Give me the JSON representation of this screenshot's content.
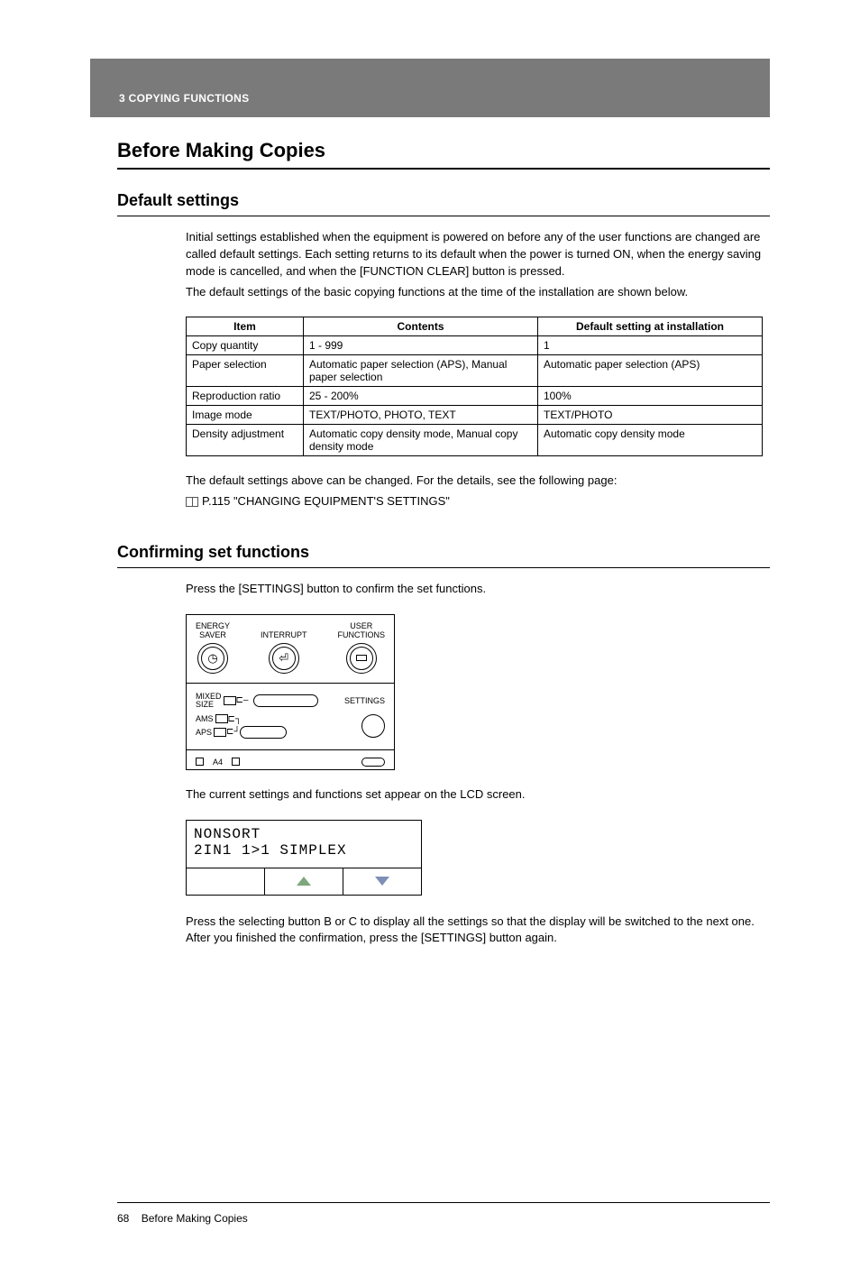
{
  "header": {
    "chapter_label": "3   COPYING FUNCTIONS"
  },
  "title": "Before Making Copies",
  "sub1": {
    "heading": "Default settings",
    "p1": "Initial settings established when the equipment is powered on before any of the user functions are changed are called default settings. Each setting returns to its default when the power is turned ON, when the energy saving mode is cancelled, and when the [FUNCTION CLEAR] button is pressed.",
    "p2": "The default settings of the basic copying functions at the time of the installation are shown below.",
    "table": {
      "headers": [
        "Item",
        "Contents",
        "Default setting at installation"
      ],
      "rows": [
        [
          "Copy quantity",
          "1 - 999",
          "1"
        ],
        [
          "Paper selection",
          "Automatic paper selection (APS), Manual paper selection",
          "Automatic paper selection (APS)"
        ],
        [
          "Reproduction ratio",
          "25 - 200%",
          "100%"
        ],
        [
          "Image mode",
          "TEXT/PHOTO, PHOTO, TEXT",
          "TEXT/PHOTO"
        ],
        [
          "Density adjustment",
          "Automatic copy density mode, Manual copy density mode",
          "Automatic copy density mode"
        ]
      ]
    },
    "p3": "The default settings above can be changed. For the details, see the following page:",
    "ref": "P.115 \"CHANGING EQUIPMENT'S SETTINGS\""
  },
  "sub2": {
    "heading": "Confirming set functions",
    "p1": "Press the [SETTINGS] button to confirm the set functions.",
    "panel": {
      "btn1_line1": "ENERGY",
      "btn1_line2": "SAVER",
      "btn2": "INTERRUPT",
      "btn3_line1": "USER",
      "btn3_line2": "FUNCTIONS",
      "mixed": "MIXED",
      "size": "SIZE",
      "ams": "AMS",
      "aps": "APS",
      "settings_label": "SETTINGS",
      "bottom_label": "A4"
    },
    "p2": "The current settings and functions set appear on the LCD screen.",
    "lcd": {
      "line1": "NONSORT",
      "line2": "2IN1 1>1 SIMPLEX"
    },
    "p3": "Press the selecting button B or C to display all the settings so that the display will be switched to the next one. After you finished the confirmation, press the [SETTINGS] button again."
  },
  "footer": {
    "page_no": "68",
    "label": "Before Making Copies"
  }
}
